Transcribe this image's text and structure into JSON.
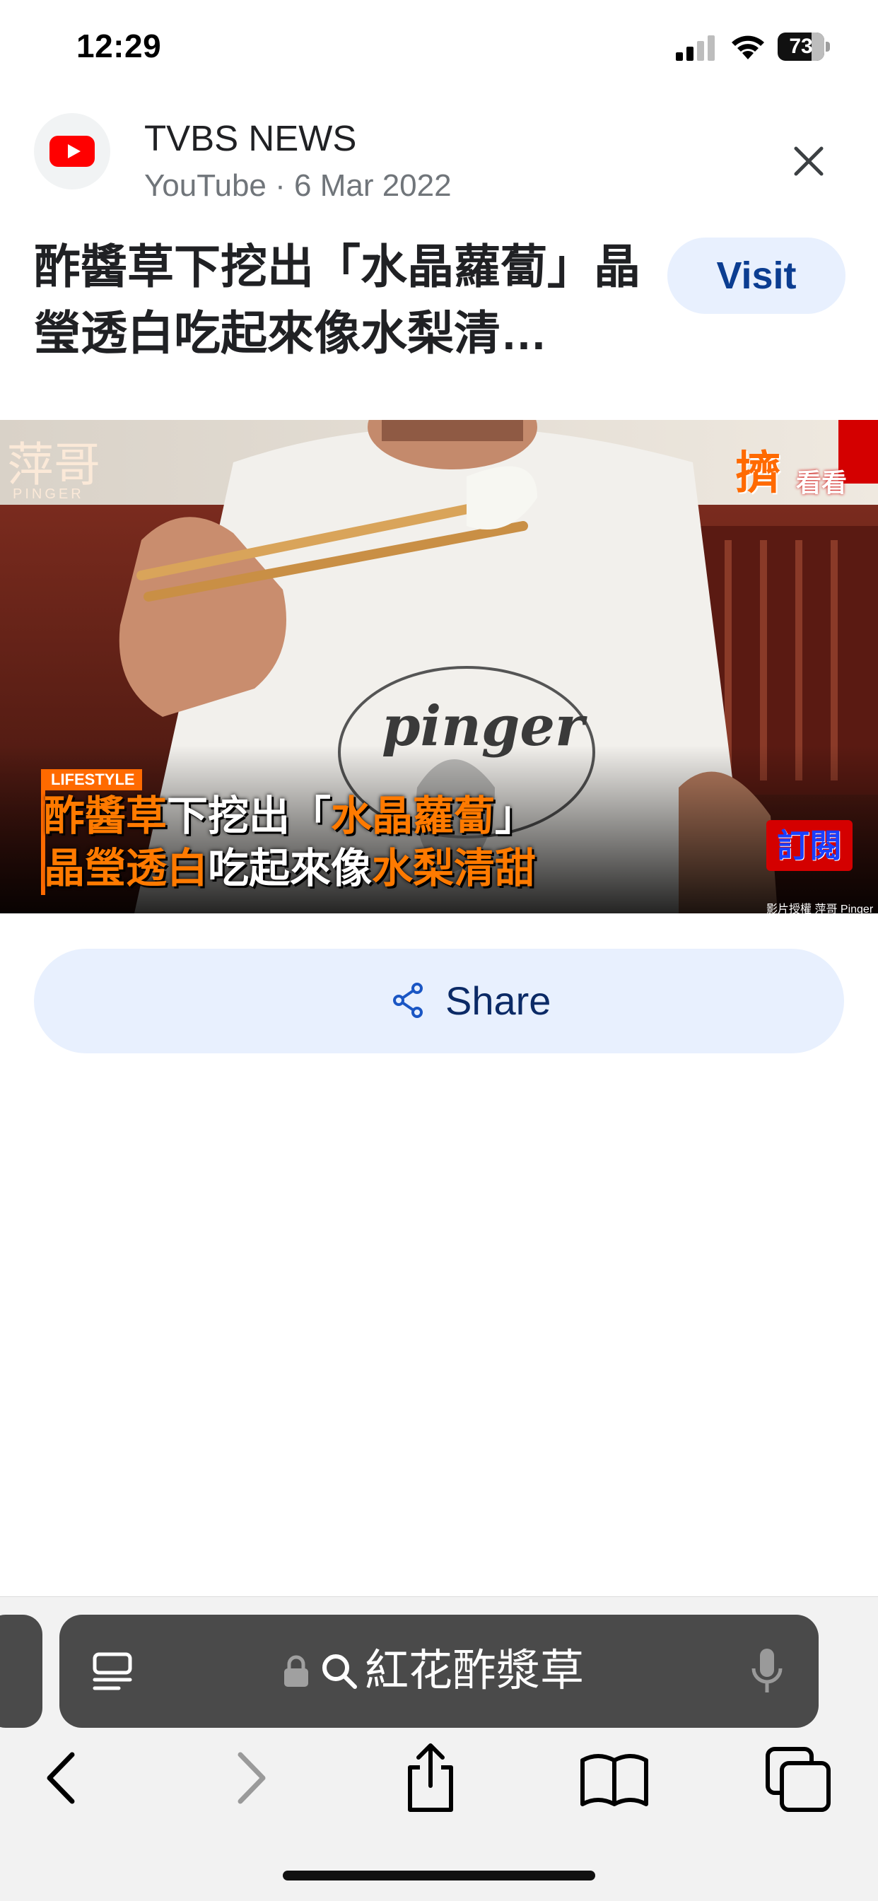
{
  "status_bar": {
    "time": "12:29",
    "battery_level": "73",
    "battery_fraction": 0.73
  },
  "result": {
    "channel_name": "TVBS NEWS",
    "source_meta": "YouTube · 6 Mar 2022",
    "title": "酢醬草下挖出「水晶蘿蔔」晶瑩透白吃起來像水梨清…",
    "visit_label": "Visit",
    "share_label": "Share"
  },
  "thumbnail": {
    "badge": "LIFESTYLE",
    "line1_highlight_a": "酢醬草",
    "line1_plain_a": "下挖出「",
    "line1_highlight_b": "水晶蘿蔔",
    "line1_plain_b": "」",
    "line2_highlight_a": "晶瑩透白",
    "line2_plain_a": "吃起來像",
    "line2_highlight_b": "水梨清甜",
    "watermark": "萍哥",
    "watermark_sub": "PINGER",
    "shirt_text": "pinger",
    "corner_tag": "擠",
    "corner_tag_sub": "看看",
    "subscribe_tag": "訂閱",
    "credit": "影片授權 萍哥 Pinger"
  },
  "browser": {
    "address_text": "紅花酢漿草"
  },
  "icons": {
    "youtube": "youtube-logo-icon",
    "close": "close-icon",
    "share": "share-icon",
    "reader": "reader-mode-icon",
    "lock": "lock-icon",
    "search": "search-icon",
    "mic": "microphone-icon",
    "back": "back-icon",
    "forward": "forward-icon",
    "share_sheet": "share-sheet-icon",
    "bookmarks": "bookmarks-icon",
    "tabs": "tabs-icon"
  },
  "colors": {
    "accent": "#e8f0fe",
    "youtube_red": "#ff0000",
    "highlight_orange": "#ff7a00"
  }
}
